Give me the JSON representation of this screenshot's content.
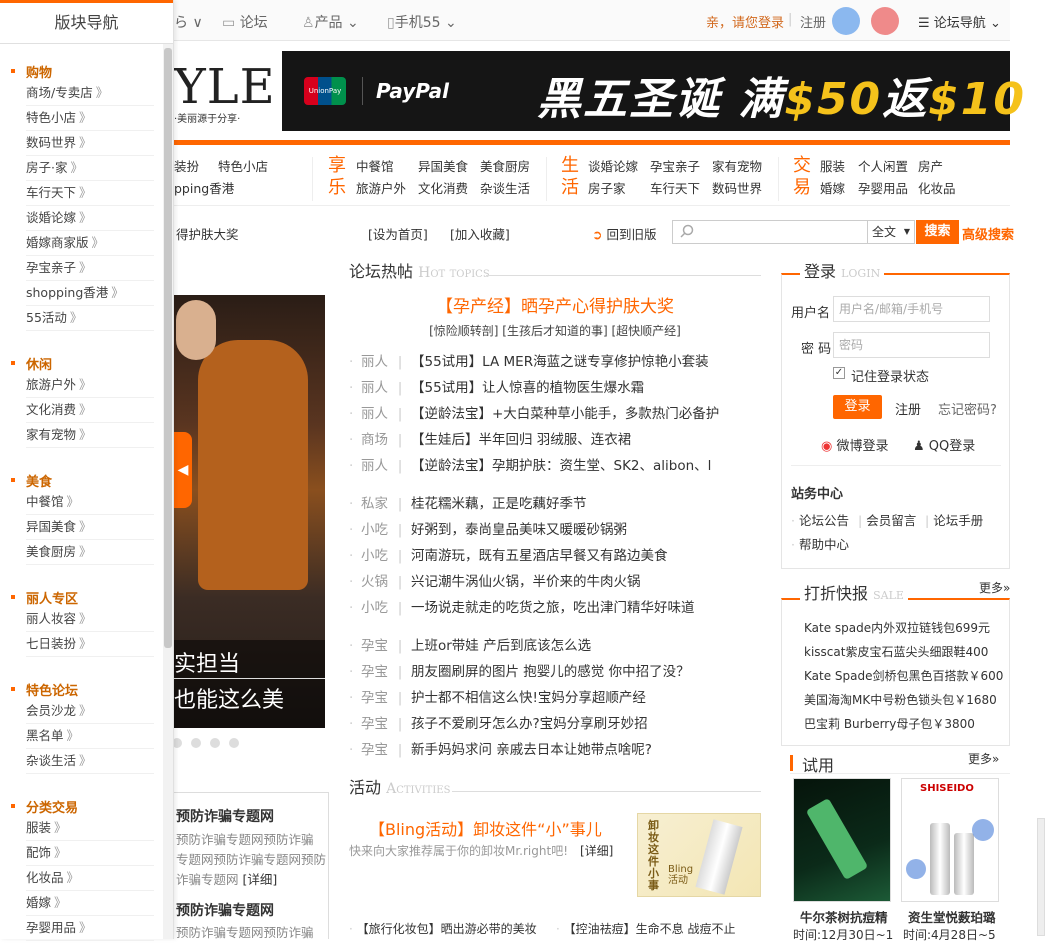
{
  "topbar": {
    "nav_partial": "ら ∨",
    "forum": "论坛",
    "product": "产品",
    "mobile": "手机55",
    "greeting": "亲，请您登录",
    "register": "注册",
    "forum_nav": "论坛导航"
  },
  "sidebar": {
    "title": "版块导航",
    "sections": [
      {
        "name": "购物",
        "items": [
          "商场/专卖店",
          "特色小店",
          "数码世界",
          "房子·家",
          "车行天下",
          "谈婚论嫁",
          "婚嫁商家版",
          "孕宝亲子",
          "shopping香港",
          "55活动"
        ]
      },
      {
        "name": "休闲",
        "items": [
          "旅游户外",
          "文化消费",
          "家有宠物"
        ]
      },
      {
        "name": "美食",
        "items": [
          "中餐馆",
          "异国美食",
          "美食厨房"
        ]
      },
      {
        "name": "丽人专区",
        "items": [
          "丽人妆容",
          "七日装扮"
        ]
      },
      {
        "name": "特色论坛",
        "items": [
          "会员沙龙",
          "黑名单",
          "杂谈生活"
        ]
      },
      {
        "name": "分类交易",
        "items": [
          "服装",
          "配饰",
          "化妆品",
          "婚嫁",
          "孕婴用品"
        ]
      }
    ],
    "arrow": "》"
  },
  "logo": {
    "text": "YLE",
    "sub": "·美丽源于分享·"
  },
  "banner": {
    "unionpay": "UnionPay",
    "paypal": "PayPal",
    "text_a": "黑五圣诞 满",
    "num1": "$50",
    "text_b": "返",
    "num2": "$10"
  },
  "catnav": {
    "left": [
      "装扮",
      "特色小店",
      "pping香港"
    ],
    "groups": [
      {
        "big": "享乐",
        "items": [
          "中餐馆",
          "异国美食",
          "美食厨房",
          "旅游户外",
          "文化消费",
          "杂谈生活"
        ]
      },
      {
        "big": "生活",
        "items": [
          "谈婚论嫁",
          "孕宝亲子",
          "家有宠物",
          "房子家",
          "车行天下",
          "数码世界"
        ]
      },
      {
        "big": "交易",
        "items": [
          "服装",
          "个人闲置",
          "房产",
          "婚嫁",
          "孕婴用品",
          "化妆品"
        ]
      }
    ]
  },
  "util": {
    "marquee": "得护肤大奖",
    "set_home": "[设为首页]",
    "favorite": "[加入收藏]",
    "old_version": "回到旧版",
    "search_scope": "全文",
    "search_btn": "搜索",
    "adv_search": "高级搜索"
  },
  "slider": {
    "line1": "实担当",
    "line2": "也能这么美"
  },
  "antifraud": {
    "title": "预防诈骗专题网",
    "lines": [
      "预防诈骗专题网预防诈骗",
      "专题网预防诈骗专题网预防",
      "诈骗专题网"
    ],
    "detail": "[详细]",
    "title2": "预防诈骗专题网",
    "line2": "预防诈骗专题网预防诈骗"
  },
  "hot": {
    "heading": "论坛热帖",
    "heading_en": "Hot topics",
    "title": "【孕产经】晒孕产心得护肤大奖",
    "sub": "[惊险顺转剖] [生孩后才知道的事] [超快顺产经]",
    "rows": [
      {
        "cat": "丽人",
        "title": "【55试用】LA MER海蓝之谜专享修护惊艳小套装"
      },
      {
        "cat": "丽人",
        "title": "【55试用】让人惊喜的植物医生爆水霜"
      },
      {
        "cat": "丽人",
        "title": "【逆龄法宝】+大白菜种草小能手，多款热门必备护"
      },
      {
        "cat": "商场",
        "title": "【生娃后】半年回归 羽绒服、连衣裙"
      },
      {
        "cat": "丽人",
        "title": "【逆龄法宝】孕期护肤：资生堂、SK2、alibon、l"
      },
      {
        "cat": "私家",
        "title": "桂花糯米藕，正是吃藕好季节"
      },
      {
        "cat": "小吃",
        "title": "好粥到，泰尚皇品美味又暖暖砂锅粥"
      },
      {
        "cat": "小吃",
        "title": "河南游玩，既有五星酒店早餐又有路边美食"
      },
      {
        "cat": "火锅",
        "title": "兴记潮牛涡仙火锅，半价来的牛肉火锅"
      },
      {
        "cat": "小吃",
        "title": "一场说走就走的吃货之旅，吃出津门精华好味道"
      },
      {
        "cat": "孕宝",
        "title": "上班or带娃 产后到底该怎么选"
      },
      {
        "cat": "孕宝",
        "title": "朋友圈刷屏的图片 抱婴儿的感觉 你中招了没？"
      },
      {
        "cat": "孕宝",
        "title": "护士都不相信这么快!宝妈分享超顺产经"
      },
      {
        "cat": "孕宝",
        "title": "孩子不爱刷牙怎么办?宝妈分享刷牙妙招"
      },
      {
        "cat": "孕宝",
        "title": "新手妈妈求问 亲戚去日本让她带点啥呢?"
      }
    ]
  },
  "activity": {
    "heading": "活动",
    "heading_en": "Activities",
    "title": "【Bling活动】卸妆这件“小”事儿",
    "desc": "快来向大家推荐属于你的卸妆Mr.right吧!",
    "detail": "[详细]",
    "img_text": "卸妆这件小事",
    "img_bling": "Bling活动",
    "bottom1": "【旅行化妆包】晒出游必带的美妆",
    "bottom2": "【控油祛痘】生命不息 战痘不止"
  },
  "login": {
    "heading": "登录",
    "heading_en": "LOGIN",
    "username_label": "用户名",
    "username_placeholder": "用户名/邮箱/手机号",
    "password_label": "密 码",
    "password_placeholder": "密码",
    "remember": "记住登录状态",
    "login_btn": "登录",
    "register": "注册",
    "forgot": "忘记密码?",
    "weibo": "微博登录",
    "qq": "QQ登录",
    "site_center": "站务中心",
    "site_links": [
      "论坛公告",
      "会员留言",
      "论坛手册",
      "帮助中心"
    ]
  },
  "deals": {
    "heading": "打折快报",
    "heading_en": "SALE",
    "more": "更多»",
    "items": [
      "Kate spade内外双拉链钱包699元",
      "kisscat紫皮宝石蓝尖头细跟鞋400",
      "Kate Spade剑桥包黑色百搭款￥600",
      "美国海淘MK中号粉色锁头包￥1680",
      "巴宝莉 Burberry母子包￥3800"
    ]
  },
  "trial": {
    "heading": "试用",
    "more": "更多»",
    "items": [
      {
        "name": "牛尔茶树抗痘精",
        "time": "时间:12月30日~1"
      },
      {
        "name": "资生堂悦薮珀璐",
        "time": "时间:4月28日~5"
      }
    ],
    "brand2": "SHISEIDO"
  }
}
